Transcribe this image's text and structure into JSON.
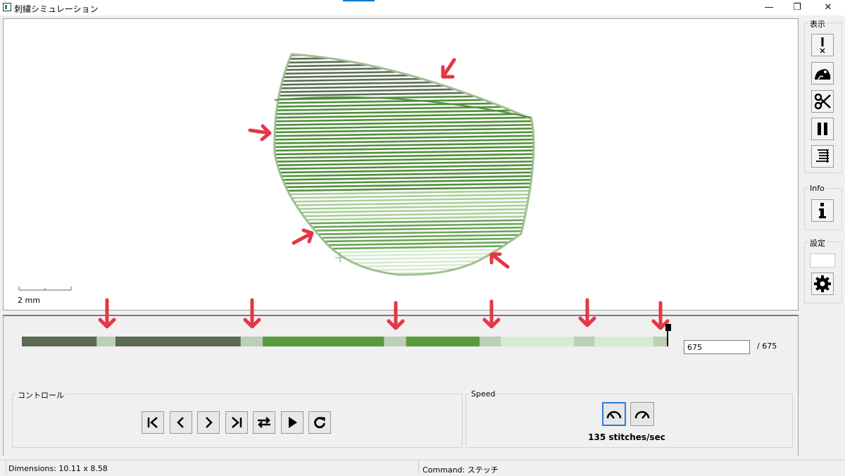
{
  "window": {
    "title": "刺繍シミュレーション",
    "minimize_glyph": "—",
    "maximize_glyph": "❐",
    "close_glyph": "✕"
  },
  "canvas": {
    "scale_label": "2 mm",
    "design_colors": [
      "#5b6e55",
      "#4f8f3a",
      "#6aa556",
      "#a9cf98",
      "#d6ebcd"
    ],
    "annotation_color": "#e53646"
  },
  "toolbar": {
    "display_label": "表示",
    "info_label": "Info",
    "settings_label": "設定",
    "display_icons": [
      "jump-stitch-icon",
      "frog-icon",
      "scissors-icon",
      "pause-icon",
      "layers-icon"
    ],
    "info_icon": "info-icon",
    "settings_icon": "gear-icon"
  },
  "timeline": {
    "segments": [
      {
        "color": "#5b6a54",
        "start": 0,
        "end": 0.116
      },
      {
        "color": "#bccfb7",
        "start": 0.116,
        "end": 0.145
      },
      {
        "color": "#5b6a54",
        "start": 0.145,
        "end": 0.339
      },
      {
        "color": "#bccfb7",
        "start": 0.339,
        "end": 0.373
      },
      {
        "color": "#5a9a3c",
        "start": 0.373,
        "end": 0.561
      },
      {
        "color": "#bccfb7",
        "start": 0.561,
        "end": 0.595
      },
      {
        "color": "#5a9a3c",
        "start": 0.595,
        "end": 0.709
      },
      {
        "color": "#bccfb7",
        "start": 0.709,
        "end": 0.742
      },
      {
        "color": "#d9ead3",
        "start": 0.742,
        "end": 0.855
      },
      {
        "color": "#bccfb7",
        "start": 0.855,
        "end": 0.887
      },
      {
        "color": "#d9ead3",
        "start": 0.887,
        "end": 0.978
      },
      {
        "color": "#bccfb7",
        "start": 0.978,
        "end": 1.0
      }
    ],
    "current_stitch": "675",
    "total_label": "/ 675"
  },
  "controls": {
    "title": "コントロール",
    "buttons": [
      "first-icon",
      "prev-icon",
      "next-icon",
      "last-icon",
      "swap-icon",
      "play-icon",
      "reload-icon"
    ]
  },
  "speed": {
    "title": "Speed",
    "value_label": "135 stitches/sec",
    "buttons": [
      "slow-gauge-icon",
      "fast-gauge-icon"
    ]
  },
  "status": {
    "dimensions": "Dimensions: 10.11 x 8.58",
    "command": "Command: ステッチ"
  }
}
